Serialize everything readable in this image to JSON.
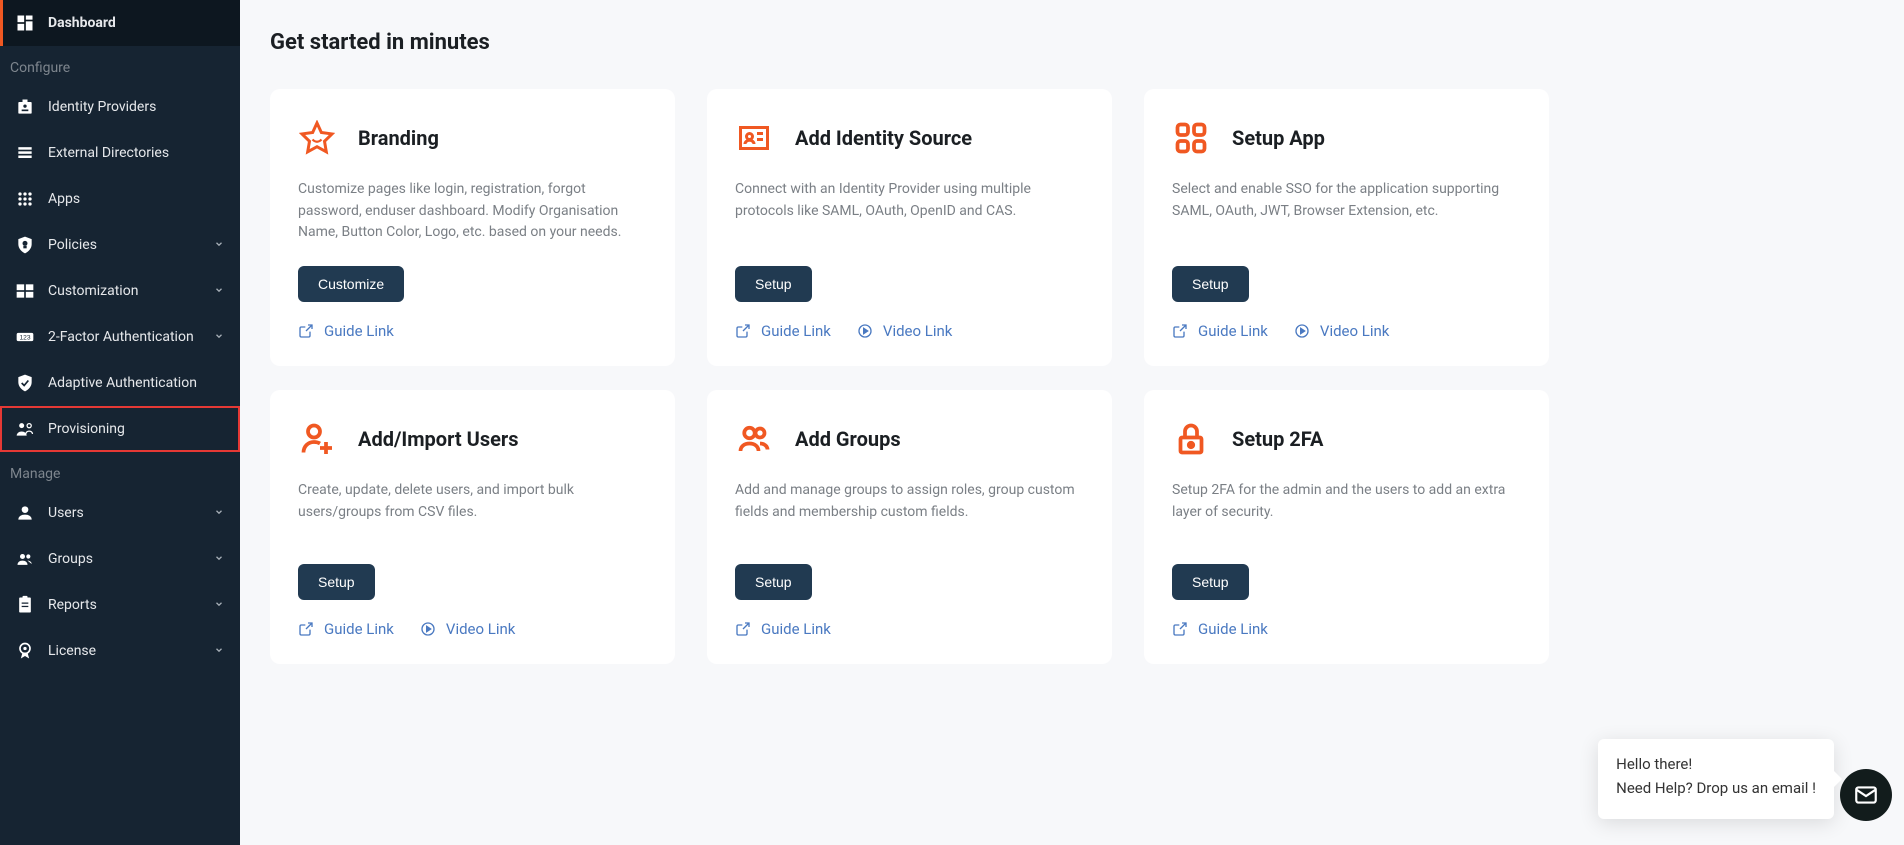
{
  "colors": {
    "accent": "#f05822",
    "link": "#4a79c1",
    "btn": "#213a51",
    "highlight": "#e53935"
  },
  "sidebar": {
    "sections": [
      {
        "type": "item",
        "label": "Dashboard",
        "icon": "dashboard-icon",
        "active": true,
        "chevron": false
      },
      {
        "type": "heading",
        "label": "Configure"
      },
      {
        "type": "item",
        "label": "Identity Providers",
        "icon": "id-provider-icon",
        "chevron": false
      },
      {
        "type": "item",
        "label": "External Directories",
        "icon": "directories-icon",
        "chevron": false
      },
      {
        "type": "item",
        "label": "Apps",
        "icon": "apps-icon",
        "chevron": false
      },
      {
        "type": "item",
        "label": "Policies",
        "icon": "policies-icon",
        "chevron": true
      },
      {
        "type": "item",
        "label": "Customization",
        "icon": "customization-icon",
        "chevron": true
      },
      {
        "type": "item",
        "label": "2-Factor Authentication",
        "icon": "2fa-icon",
        "chevron": true
      },
      {
        "type": "item",
        "label": "Adaptive Authentication",
        "icon": "adaptive-icon",
        "chevron": false
      },
      {
        "type": "item",
        "label": "Provisioning",
        "icon": "provisioning-icon",
        "chevron": false,
        "highlighted": true
      },
      {
        "type": "heading",
        "label": "Manage"
      },
      {
        "type": "item",
        "label": "Users",
        "icon": "users-icon",
        "chevron": true
      },
      {
        "type": "item",
        "label": "Groups",
        "icon": "groups-icon",
        "chevron": true
      },
      {
        "type": "item",
        "label": "Reports",
        "icon": "reports-icon",
        "chevron": true
      },
      {
        "type": "item",
        "label": "License",
        "icon": "license-icon",
        "chevron": true
      }
    ]
  },
  "main": {
    "title": "Get started in minutes",
    "cards": [
      {
        "title": "Branding",
        "icon": "star-icon",
        "desc": "Customize pages like login, registration, forgot password, enduser dashboard. Modify Organisation Name, Button Color, Logo, etc. based on your needs.",
        "btn": "Customize",
        "links": [
          {
            "label": "Guide Link",
            "icon": "open-icon"
          }
        ]
      },
      {
        "title": "Add Identity Source",
        "icon": "id-card-icon",
        "desc": "Connect with an Identity Provider using multiple protocols like SAML, OAuth, OpenID and CAS.",
        "btn": "Setup",
        "links": [
          {
            "label": "Guide Link",
            "icon": "open-icon"
          },
          {
            "label": "Video Link",
            "icon": "play-icon"
          }
        ]
      },
      {
        "title": "Setup App",
        "icon": "app-grid-icon",
        "desc": "Select and enable SSO for the application supporting SAML, OAuth, JWT, Browser Extension, etc.",
        "btn": "Setup",
        "links": [
          {
            "label": "Guide Link",
            "icon": "open-icon"
          },
          {
            "label": "Video Link",
            "icon": "play-icon"
          }
        ]
      },
      {
        "title": "Add/Import Users",
        "icon": "add-user-icon",
        "desc": "Create, update, delete users, and import bulk users/groups from CSV files.",
        "btn": "Setup",
        "links": [
          {
            "label": "Guide Link",
            "icon": "open-icon"
          },
          {
            "label": "Video Link",
            "icon": "play-icon"
          }
        ]
      },
      {
        "title": "Add Groups",
        "icon": "add-group-icon",
        "desc": "Add and manage groups to assign roles, group custom fields and membership custom fields.",
        "btn": "Setup",
        "links": [
          {
            "label": "Guide Link",
            "icon": "open-icon"
          }
        ]
      },
      {
        "title": "Setup 2FA",
        "icon": "lock-icon",
        "desc": "Setup 2FA for the admin and the users to add an extra layer of security.",
        "btn": "Setup",
        "links": [
          {
            "label": "Guide Link",
            "icon": "open-icon"
          }
        ]
      }
    ]
  },
  "chat": {
    "line1": "Hello there!",
    "line2": "Need Help? Drop us an email !"
  }
}
